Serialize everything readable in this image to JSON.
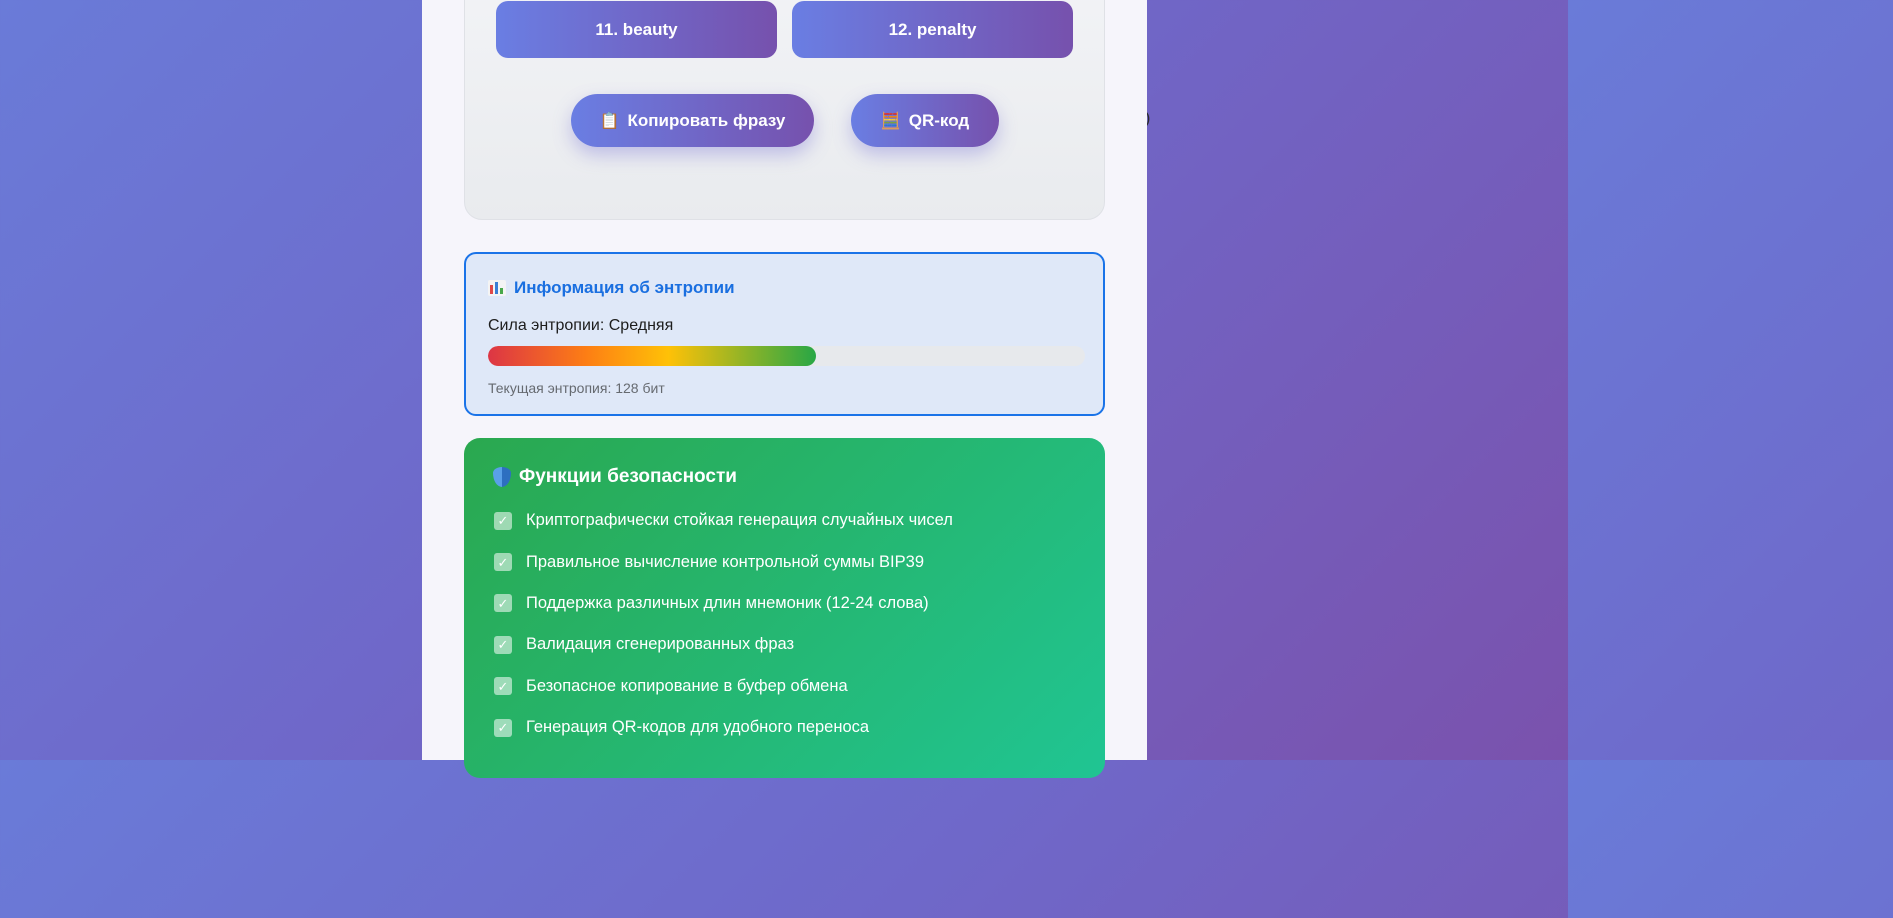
{
  "stray_text": ")",
  "mnemonic": {
    "words": [
      {
        "label": "11. beauty"
      },
      {
        "label": "12. penalty"
      }
    ],
    "copy_button": {
      "icon": "📋",
      "label": "Копировать фразу"
    },
    "qr_button": {
      "icon": "🧮",
      "label": "QR-код"
    }
  },
  "entropy": {
    "title": "Информация об энтропии",
    "strength_label": "Сила энтропии:",
    "strength_value": "Средняя",
    "strength_fill_fraction": 0.55,
    "current": "Текущая энтропия: 128 бит"
  },
  "security": {
    "title": "Функции безопасности",
    "items": [
      "Криптографически стойкая генерация случайных чисел",
      "Правильное вычисление контрольной суммы BIP39",
      "Поддержка различных длин мнемоник (12-24 слова)",
      "Валидация сгенерированных фраз",
      "Безопасное копирование в буфер обмена",
      "Генерация QR-кодов для удобного переноса"
    ]
  },
  "colors": {
    "accent_blue": "#1a73e8",
    "button_gradient_start": "#6a7ee3",
    "button_gradient_end": "#7651ad",
    "security_green": "#2aa84f"
  }
}
